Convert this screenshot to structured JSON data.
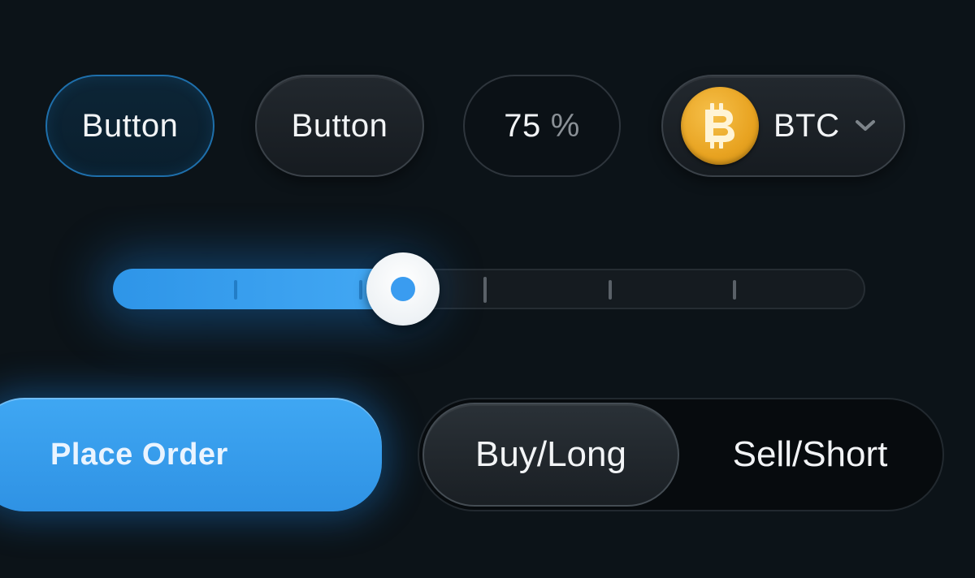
{
  "buttons": {
    "primary_label": "Button",
    "secondary_label": "Button"
  },
  "percent_field": {
    "value": "75",
    "unit": "%"
  },
  "coin_select": {
    "symbol": "BTC",
    "icon": "bitcoin-icon",
    "dropdown_icon": "chevron-down-icon"
  },
  "slider": {
    "value_fraction": 0.385,
    "tick_count": 5
  },
  "order": {
    "place_order_label": "Place Order"
  },
  "side_toggle": {
    "options": [
      "Buy/Long",
      "Sell/Short"
    ],
    "selected": "Buy/Long"
  },
  "colors": {
    "background": "#0c1318",
    "accent_blue": "#3fa7f3",
    "bitcoin_gold": "#e8a321",
    "primary_border": "#1e6fab"
  }
}
